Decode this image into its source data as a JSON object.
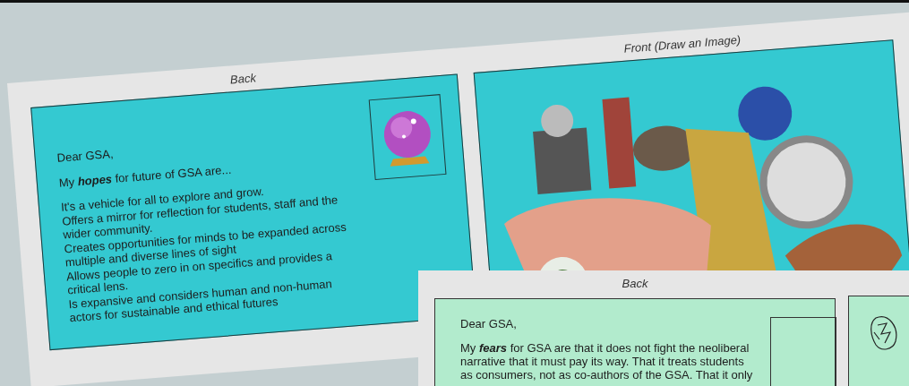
{
  "tilted_board": {
    "back_card": {
      "label": "Back",
      "greeting": "Dear GSA,",
      "intro": "My **hopes** for future of GSA are...",
      "lines": [
        "It's a vehicle for all to explore and grow.",
        "Offers a mirror for reflection for students, staff and the",
        "wider community.",
        "Creates opportunities for minds to be expanded across",
        "multiple and diverse lines of sight",
        "Allows people to zero in on specifics and provides a",
        "critical lens.",
        "Is expansive and considers human and non-human",
        "actors for sustainable and ethical futures"
      ]
    },
    "front_card": {
      "label": "Front (Draw an Image)"
    }
  },
  "front_board": {
    "back_card": {
      "label": "Back",
      "greeting": "Dear GSA,",
      "lines": [
        "My **fears** for GSA are that it does not fight the neoliberal",
        "narrative that it must pay its way. That it treats students",
        "as consumers, not as co-authors of the GSA. That it only"
      ]
    }
  }
}
